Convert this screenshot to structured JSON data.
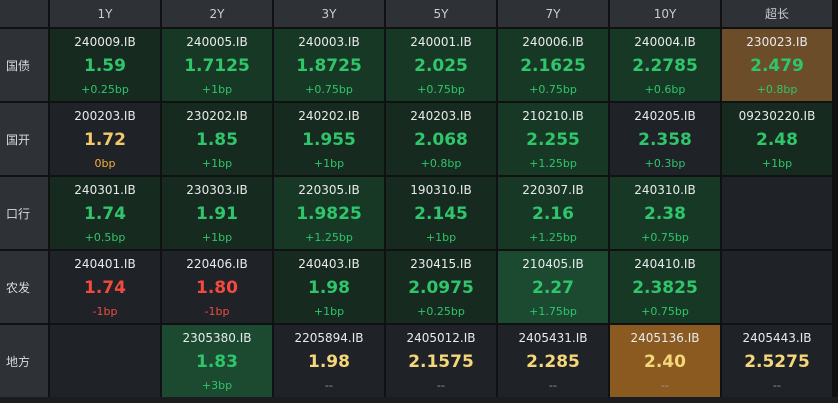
{
  "headers": [
    "1Y",
    "2Y",
    "3Y",
    "5Y",
    "7Y",
    "10Y",
    "超长"
  ],
  "rows": [
    {
      "label": "国债",
      "cells": [
        {
          "code": "240009.IB",
          "rate": "1.59",
          "chg": "+0.25bp"
        },
        {
          "code": "240005.IB",
          "rate": "1.7125",
          "chg": "+1bp"
        },
        {
          "code": "240003.IB",
          "rate": "1.8725",
          "chg": "+0.75bp"
        },
        {
          "code": "240001.IB",
          "rate": "2.025",
          "chg": "+0.75bp"
        },
        {
          "code": "240006.IB",
          "rate": "2.1625",
          "chg": "+0.75bp"
        },
        {
          "code": "240004.IB",
          "rate": "2.2785",
          "chg": "+0.6bp"
        },
        {
          "code": "230023.IB",
          "rate": "2.479",
          "chg": "+0.8bp"
        }
      ]
    },
    {
      "label": "国开",
      "cells": [
        {
          "code": "200203.IB",
          "rate": "1.72",
          "chg": "0bp"
        },
        {
          "code": "230202.IB",
          "rate": "1.85",
          "chg": "+1bp"
        },
        {
          "code": "240202.IB",
          "rate": "1.955",
          "chg": "+1bp"
        },
        {
          "code": "240203.IB",
          "rate": "2.068",
          "chg": "+0.8bp"
        },
        {
          "code": "210210.IB",
          "rate": "2.255",
          "chg": "+1.25bp"
        },
        {
          "code": "240205.IB",
          "rate": "2.358",
          "chg": "+0.3bp"
        },
        {
          "code": "09230220.IB",
          "rate": "2.48",
          "chg": "+1bp"
        }
      ]
    },
    {
      "label": "口行",
      "cells": [
        {
          "code": "240301.IB",
          "rate": "1.74",
          "chg": "+0.5bp"
        },
        {
          "code": "230303.IB",
          "rate": "1.91",
          "chg": "+1bp"
        },
        {
          "code": "220305.IB",
          "rate": "1.9825",
          "chg": "+1.25bp"
        },
        {
          "code": "190310.IB",
          "rate": "2.145",
          "chg": "+1bp"
        },
        {
          "code": "220307.IB",
          "rate": "2.16",
          "chg": "+1.25bp"
        },
        {
          "code": "240310.IB",
          "rate": "2.38",
          "chg": "+0.75bp"
        },
        null
      ]
    },
    {
      "label": "农发",
      "cells": [
        {
          "code": "240401.IB",
          "rate": "1.74",
          "chg": "-1bp"
        },
        {
          "code": "220406.IB",
          "rate": "1.80",
          "chg": "-1bp"
        },
        {
          "code": "240403.IB",
          "rate": "1.98",
          "chg": "+1bp"
        },
        {
          "code": "230415.IB",
          "rate": "2.0975",
          "chg": "+0.25bp"
        },
        {
          "code": "210405.IB",
          "rate": "2.27",
          "chg": "+1.75bp"
        },
        {
          "code": "240410.IB",
          "rate": "2.3825",
          "chg": "+0.75bp"
        },
        null
      ]
    },
    {
      "label": "地方",
      "cells": [
        null,
        {
          "code": "2305380.IB",
          "rate": "1.83",
          "chg": "+3bp"
        },
        {
          "code": "2205894.IB",
          "rate": "1.98",
          "chg": "--"
        },
        {
          "code": "2405012.IB",
          "rate": "2.1575",
          "chg": "--"
        },
        {
          "code": "2405431.IB",
          "rate": "2.285",
          "chg": "--"
        },
        {
          "code": "2405136.IB",
          "rate": "2.40",
          "chg": "--"
        },
        {
          "code": "2405443.IB",
          "rate": "2.5275",
          "chg": "--"
        }
      ]
    }
  ],
  "colors": {
    "up": "#2fc56b",
    "flat": "#f3c96a",
    "down": "#f24a3f",
    "nodata": "#f5d77a"
  }
}
